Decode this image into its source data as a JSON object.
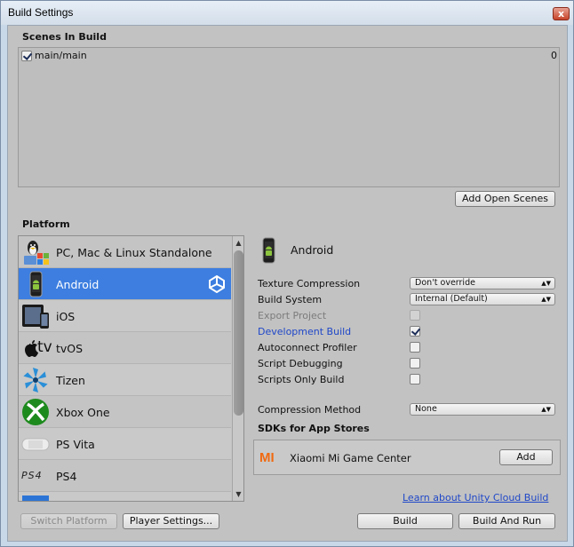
{
  "window": {
    "title": "Build Settings",
    "close_glyph": "x"
  },
  "scenes": {
    "header": "Scenes In Build",
    "items": [
      {
        "name": "main/main",
        "index": "0",
        "checked": true
      }
    ],
    "add_open_scenes": "Add Open Scenes"
  },
  "platform": {
    "header": "Platform",
    "items": [
      {
        "label": "PC, Mac & Linux Standalone",
        "icon": "pc-mac-linux-icon"
      },
      {
        "label": "Android",
        "icon": "android-icon",
        "selected": true
      },
      {
        "label": "iOS",
        "icon": "ios-icon"
      },
      {
        "label": "tvOS",
        "icon": "tvos-icon"
      },
      {
        "label": "Tizen",
        "icon": "tizen-icon"
      },
      {
        "label": "Xbox One",
        "icon": "xbox-icon"
      },
      {
        "label": "PS Vita",
        "icon": "ps-vita-icon"
      },
      {
        "label": "PS4",
        "icon": "ps4-icon"
      }
    ]
  },
  "selected_platform": {
    "name": "Android",
    "settings": {
      "texture_compression": {
        "label": "Texture Compression",
        "value": "Don't override"
      },
      "build_system": {
        "label": "Build System",
        "value": "Internal (Default)"
      },
      "export_project": {
        "label": "Export Project",
        "checked": false,
        "disabled": true
      },
      "development_build": {
        "label": "Development Build",
        "checked": true
      },
      "autoconnect_profiler": {
        "label": "Autoconnect Profiler",
        "checked": false
      },
      "script_debugging": {
        "label": "Script Debugging",
        "checked": false
      },
      "scripts_only_build": {
        "label": "Scripts Only Build",
        "checked": false
      },
      "compression_method": {
        "label": "Compression Method",
        "value": "None"
      }
    },
    "sdks": {
      "header": "SDKs for App Stores",
      "items": [
        {
          "name": "Xiaomi Mi Game Center",
          "button": "Add",
          "logo": "MI"
        }
      ]
    },
    "cloud_link": "Learn about Unity Cloud Build"
  },
  "footer": {
    "switch_platform": "Switch Platform",
    "player_settings": "Player Settings...",
    "build": "Build",
    "build_and_run": "Build And Run"
  },
  "tv_text": "tv",
  "ps4_text": "PS4",
  "colors": {
    "selection": "#3d7ee0",
    "link": "#1f47c8",
    "xbox_green": "#1d8a1d",
    "mi_orange": "#f06a10"
  }
}
